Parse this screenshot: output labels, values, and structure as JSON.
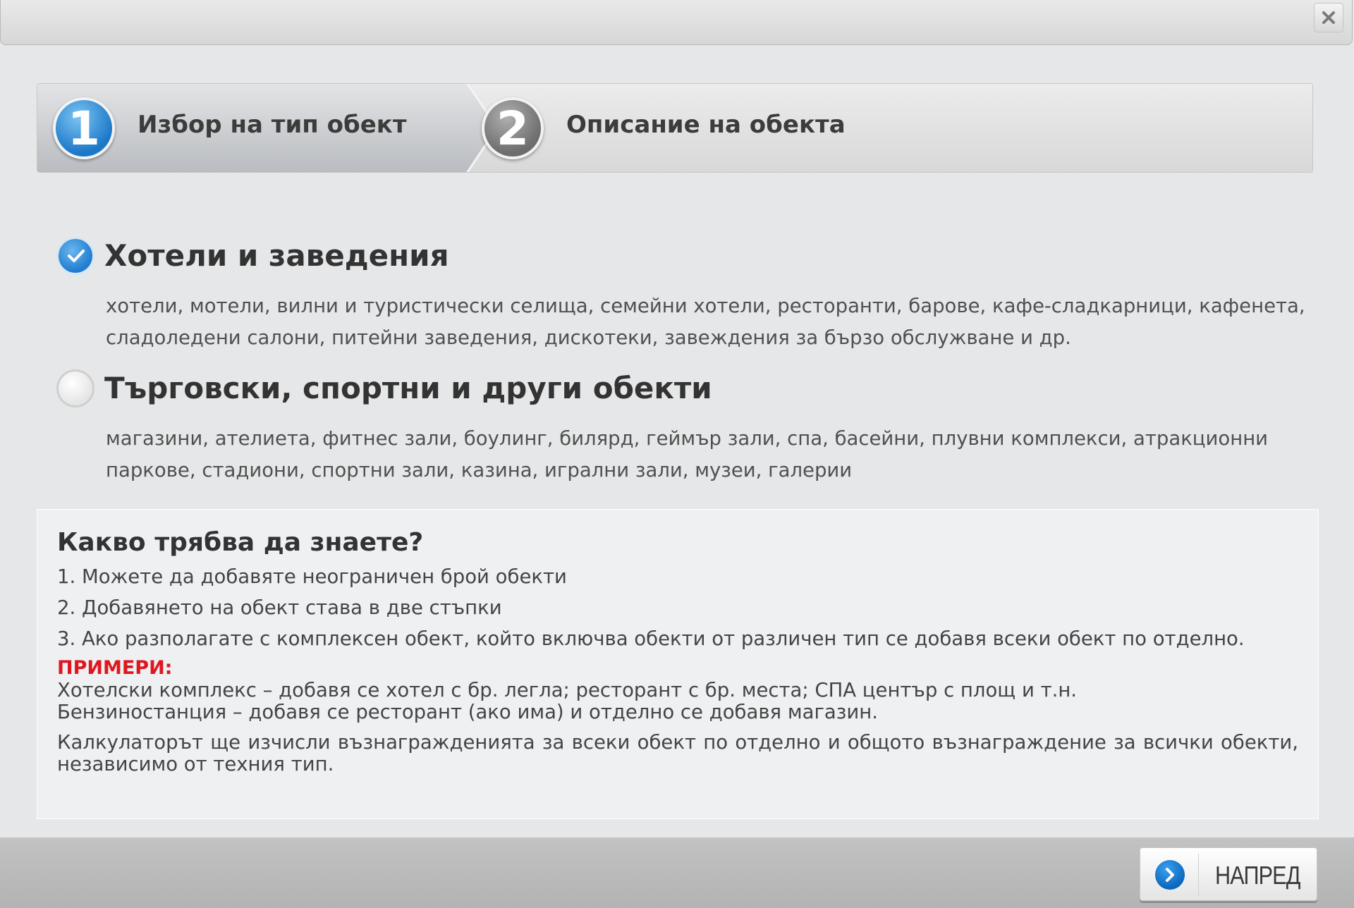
{
  "dialog": {
    "close_icon": "close-icon"
  },
  "wizard": {
    "steps": [
      {
        "number": "1",
        "label": "Избор на тип обект",
        "state": "active"
      },
      {
        "number": "2",
        "label": "Описание на обекта",
        "state": "inactive"
      }
    ]
  },
  "options": [
    {
      "title": "Хотели и заведения",
      "description": "хотели, мотели, вилни и туристически селища, семейни хотели, ресторанти, барове, кафе-сладкарници, кафенета, сладоледени салони, питейни заведения, дискотеки, завеждения за бързо обслужване и др.",
      "checked": true
    },
    {
      "title": "Търговски, спортни и други обекти",
      "description": "магазини, ателиета, фитнес зали, боулинг, билярд, геймър зали, спа, басейни, плувни комплекси, атракционни паркове, стадиони, спортни зали, казина, игрални зали, музеи, галерии",
      "checked": false
    }
  ],
  "info": {
    "title": "Какво трябва да знаете?",
    "items": [
      "1. Можете да добавяте неограничен брой обекти",
      "2. Добавянето на обект става в две стъпки",
      "3. Ако разполагате с комплексен обект, който включва обекти от различен тип се добавя всеки обект по отделно."
    ],
    "examples_label": "ПРИМЕРИ:",
    "examples": [
      "Хотелски комплекс – добавя се хотел с бр. легла; ресторант с бр. места; СПА център с площ и т.н.",
      "Бензиностанция – добавя се ресторант (ако има) и отделно се добавя магазин."
    ],
    "calc_note": "Калкулаторът ще изчисли възнагражденията за всеки обект по отделно и общото възнаграждение за всички обекти, независимо от техния тип."
  },
  "footer": {
    "next_label": "НАПРЕД",
    "next_icon": "chevron-right-icon"
  },
  "colors": {
    "accent": "#1f7ccf",
    "examples_red": "#e0161e"
  }
}
